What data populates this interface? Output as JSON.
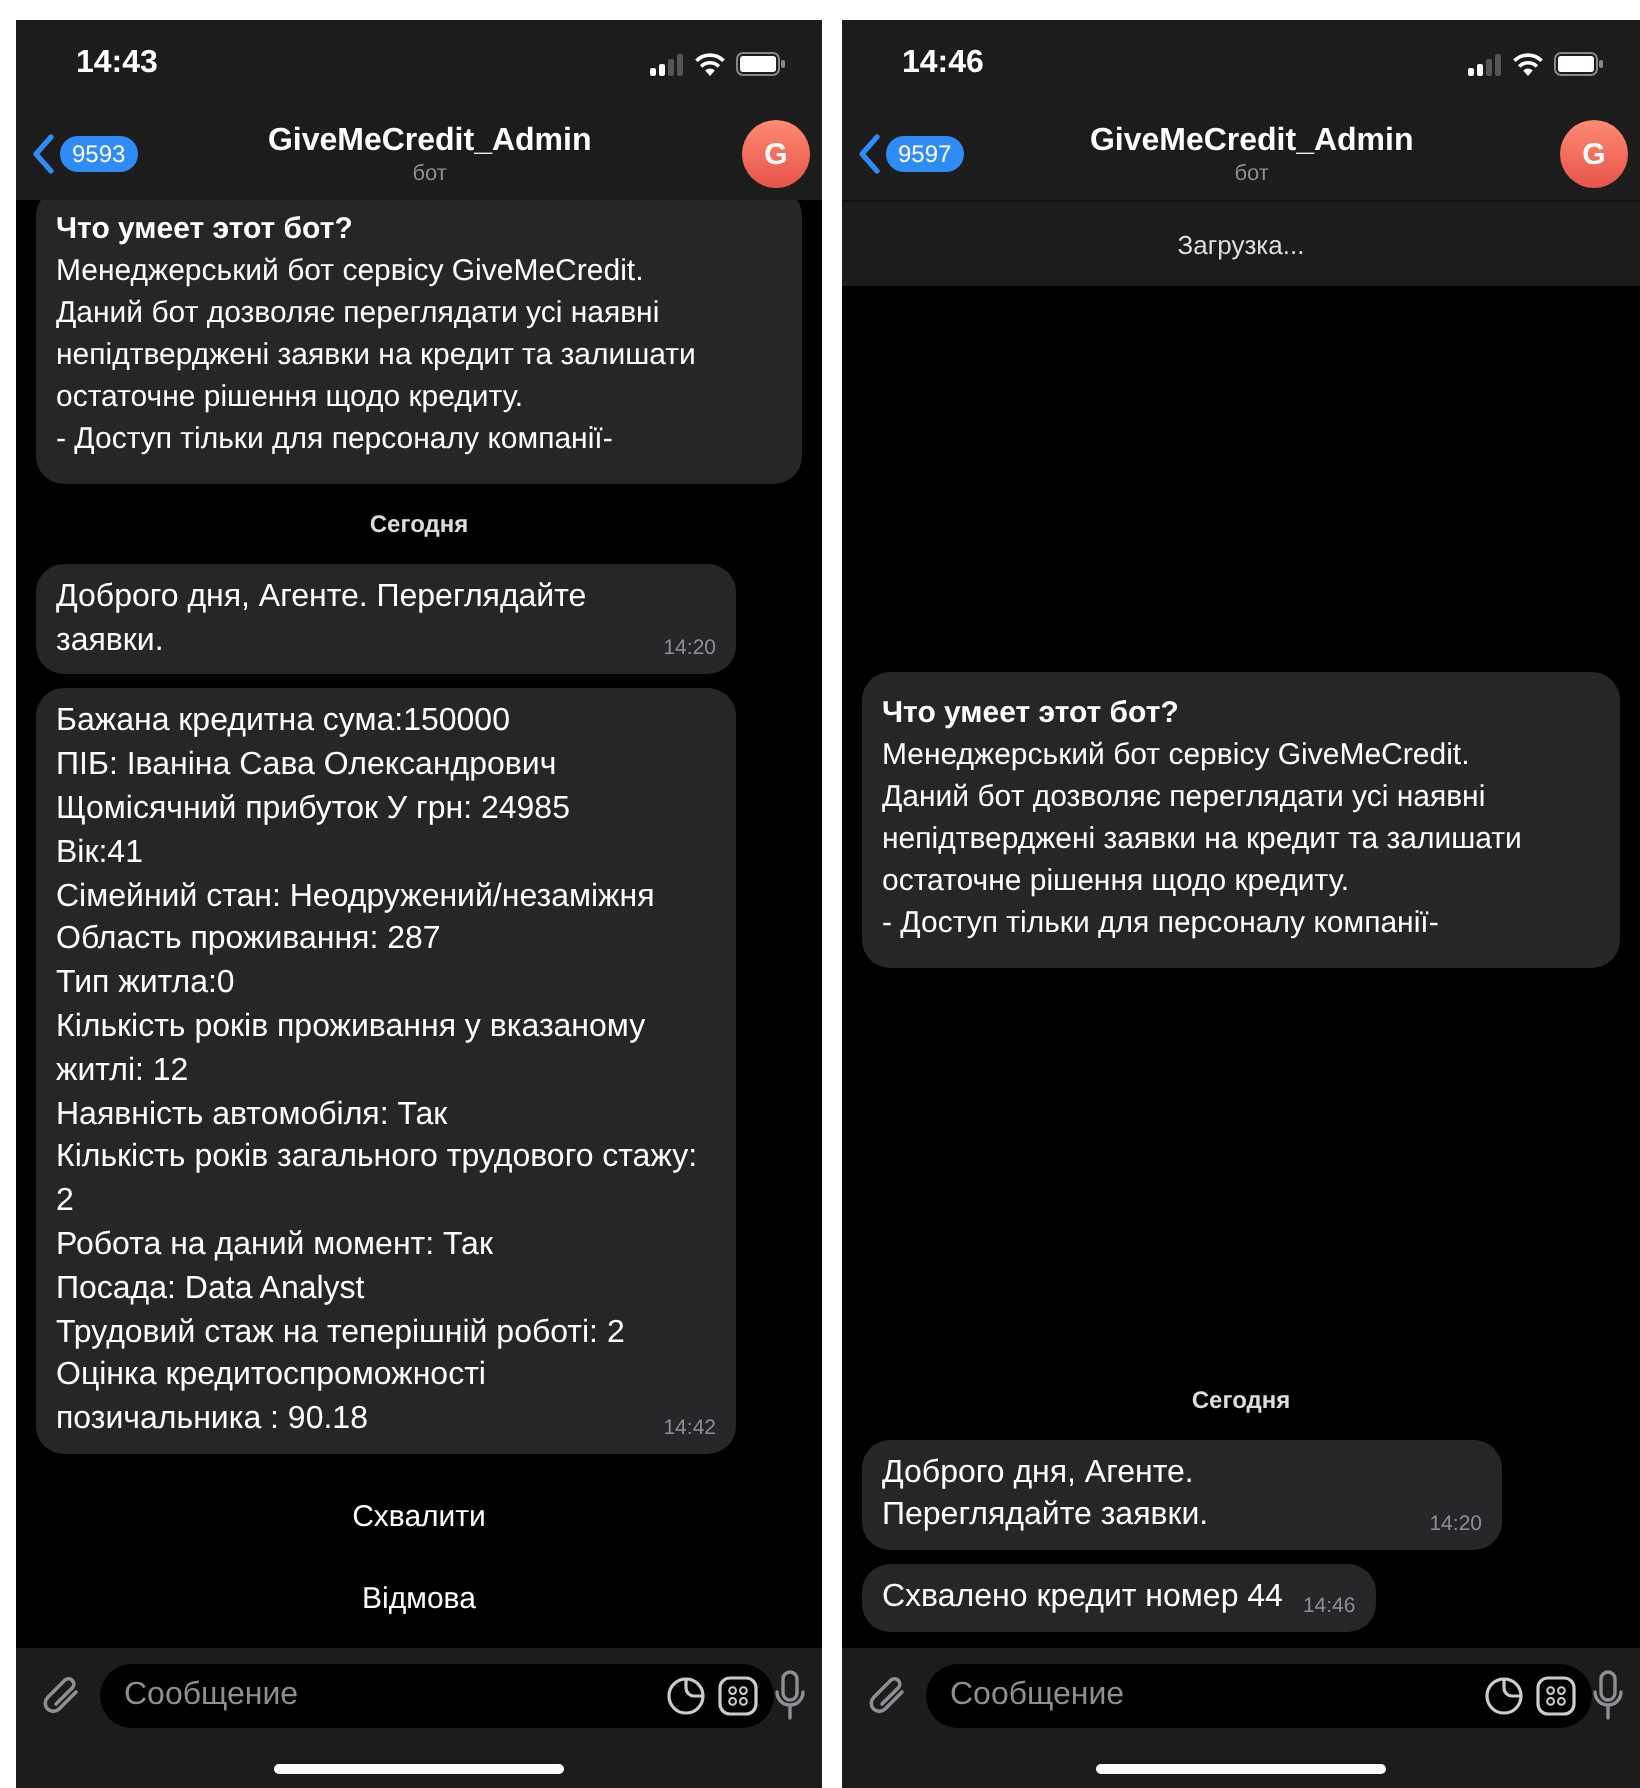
{
  "screens": [
    {
      "status_time": "14:43",
      "back_badge": "9593",
      "title": "GiveMeCredit_Admin",
      "subtitle": "бот",
      "avatar": "G",
      "messages": [
        {
          "kind": "info",
          "title": "Что умеет этот бот?",
          "lines": [
            "Менеджерський бот сервісу GiveMeCredit.",
            "Даний бот дозволяє переглядати усі наявні непідтверджені заявки на кредит та залишати остаточне рішення щодо кредиту.",
            "- Доступ тільки для персоналу компанії-"
          ]
        },
        {
          "kind": "date",
          "text": "Сегодня"
        },
        {
          "kind": "text",
          "lines": [
            "Доброго дня, Агенте. Переглядайте заявки."
          ],
          "time": "14:20"
        },
        {
          "kind": "text",
          "lines": [
            "Бажана кредитна сума:150000",
            "ПІБ: Іваніна Сава Олександрович",
            "Щомісячний прибуток У грн: 24985",
            "Вік:41",
            "Сімейний стан: Неодружений/незаміжня",
            "Область проживання: 287",
            "Тип житла:0",
            "Кількість років проживання у вказаному житлі: 12",
            "Наявність автомобіля: Так",
            "Кількість років загального трудового стажу: 2",
            "Робота на даний момент: Так",
            "Посада: Data Analyst",
            "Трудовий стаж на теперішній роботі: 2",
            "Оцінка кредитоспроможності позичальника : 90.18"
          ],
          "time": "14:42"
        }
      ],
      "keyboard_buttons": [
        "Схвалити",
        "Відмова"
      ],
      "input_placeholder": "Сообщение"
    },
    {
      "status_time": "14:46",
      "back_badge": "9597",
      "title": "GiveMeCredit_Admin",
      "subtitle": "бот",
      "avatar": "G",
      "loading_text": "Загрузка...",
      "messages": [
        {
          "kind": "info",
          "title": "Что умеет этот бот?",
          "lines": [
            "Менеджерський бот сервісу GiveMeCredit.",
            "Даний бот дозволяє переглядати усі наявні непідтверджені заявки на кредит та залишати остаточне рішення щодо кредиту.",
            "- Доступ тільки для персоналу компанії-"
          ]
        },
        {
          "kind": "date",
          "text": "Сегодня"
        },
        {
          "kind": "text",
          "lines": [
            "Доброго дня, Агенте. Переглядайте заявки."
          ],
          "time": "14:20"
        },
        {
          "kind": "text",
          "lines": [
            "Схвалено кредит номер 44"
          ],
          "time": "14:46"
        }
      ],
      "input_placeholder": "Сообщение"
    }
  ]
}
